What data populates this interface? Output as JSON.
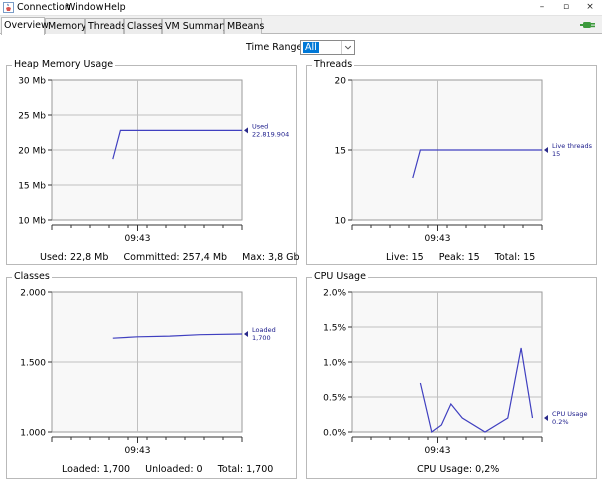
{
  "menubar": {
    "items": [
      "Connection",
      "Window",
      "Help"
    ]
  },
  "window_buttons": {
    "minimize": "–",
    "restore": "▫",
    "close": "×"
  },
  "tabs": [
    {
      "label": "Overview",
      "active": true
    },
    {
      "label": "Memory",
      "active": false
    },
    {
      "label": "Threads",
      "active": false
    },
    {
      "label": "Classes",
      "active": false
    },
    {
      "label": "VM Summary",
      "active": false
    },
    {
      "label": "MBeans",
      "active": false
    }
  ],
  "time_range": {
    "label": "Time Range:",
    "value": "All"
  },
  "panels": [
    {
      "title": "Heap Memory Usage",
      "stats": "Used: 22,8 Mb     Committed: 257,4 Mb     Max: 3,8 Gb",
      "chart_data": {
        "type": "line",
        "title": "Heap Memory Usage",
        "yticks": [
          "30 Mb",
          "25 Mb",
          "20 Mb",
          "15 Mb",
          "10 Mb"
        ],
        "ylim": [
          10,
          30
        ],
        "xticks": [
          "09:43"
        ],
        "series": [
          {
            "name": "Used",
            "color": "#4040c0",
            "t": [
              0.32,
              0.36,
              1.0
            ],
            "values": [
              18.7,
              22.8,
              22.8
            ]
          }
        ],
        "legend": {
          "label": "Used",
          "value": "22.819.904",
          "value_data": 22.8
        }
      }
    },
    {
      "title": "Threads",
      "stats": "Live: 15     Peak: 15     Total: 15",
      "chart_data": {
        "type": "line",
        "title": "Threads",
        "yticks": [
          "20",
          "15",
          "10"
        ],
        "ylim": [
          10,
          20
        ],
        "xticks": [
          "09:43"
        ],
        "series": [
          {
            "name": "Live threads",
            "color": "#4040c0",
            "t": [
              0.32,
              0.36,
              1.0
            ],
            "values": [
              13,
              15,
              15
            ]
          }
        ],
        "legend": {
          "label": "Live threads",
          "value": "15",
          "value_data": 15
        }
      }
    },
    {
      "title": "Classes",
      "stats": "Loaded: 1,700     Unloaded: 0     Total: 1,700",
      "chart_data": {
        "type": "line",
        "title": "Classes",
        "yticks": [
          "2.000",
          "1.500",
          "1.000"
        ],
        "ylim": [
          1000,
          2000
        ],
        "xticks": [
          "09:43"
        ],
        "series": [
          {
            "name": "Loaded",
            "color": "#4040c0",
            "t": [
              0.32,
              0.45,
              0.62,
              0.78,
              1.0
            ],
            "values": [
              1670,
              1680,
              1685,
              1695,
              1700
            ]
          }
        ],
        "legend": {
          "label": "Loaded",
          "value": "1,700",
          "value_data": 1700
        }
      }
    },
    {
      "title": "CPU Usage",
      "stats": "CPU Usage: 0,2%",
      "chart_data": {
        "type": "line",
        "title": "CPU Usage",
        "yticks": [
          "2.0%",
          "1.5%",
          "1.0%",
          "0.5%",
          "0.0%"
        ],
        "ylim": [
          0,
          2.0
        ],
        "xticks": [
          "09:43"
        ],
        "series": [
          {
            "name": "CPU Usage",
            "color": "#4040c0",
            "t": [
              0.36,
              0.42,
              0.47,
              0.52,
              0.58,
              0.7,
              0.82,
              0.89,
              0.95
            ],
            "values": [
              0.7,
              0.0,
              0.1,
              0.4,
              0.2,
              0.0,
              0.2,
              1.2,
              0.2
            ]
          }
        ],
        "legend": {
          "label": "CPU Usage",
          "value": "0.2%",
          "value_data": 0.2
        }
      }
    }
  ]
}
